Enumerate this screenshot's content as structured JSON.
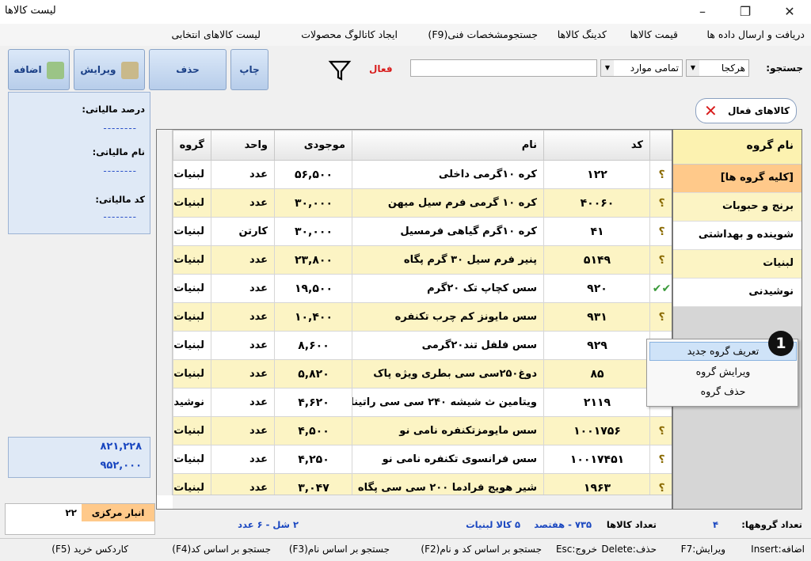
{
  "window": {
    "title": "لیست کالاها"
  },
  "menu": [
    "دریافت و ارسال داده ها",
    "قیمت کالاها",
    "کدینگ کالاها",
    "جستجومشخصات فنی(F9)",
    "ایجاد کاتالوگ محصولات",
    "لیست کالاهای انتخابی"
  ],
  "toolbar": {
    "add": "اضافه",
    "edit": "ویرایش",
    "delete": "حذف",
    "print": "چاپ"
  },
  "search": {
    "label": "جستجو:",
    "field": "هرکجا",
    "scope": "تمامی موارد",
    "value": "",
    "active_label": "فعال"
  },
  "left_panel": {
    "tax_percent_label": "درصد  مالیاتی:",
    "tax_name_label": "نام مالیاتی:",
    "tax_code_label": "کد مالیاتی:",
    "placeholder": "--------",
    "sum1": "۸۲۱,۲۲۸",
    "sum2": "۹۵۲,۰۰۰",
    "warehouse_name": "انبار مرکزی",
    "warehouse_qty": "۲۲"
  },
  "active_badge": "کالاهای فعال",
  "table": {
    "columns": [
      "کد",
      "نام",
      "موجودی",
      "واحد",
      "گروه"
    ],
    "rows": [
      {
        "mark": "؟",
        "code": "۱۲۲",
        "name": "کره ۱۰گرمی داخلی",
        "stock": "۵۶,۵۰۰",
        "unit": "عدد",
        "group": "لبنیات"
      },
      {
        "mark": "؟",
        "code": "۴۰۰۶۰",
        "name": "کره ۱۰ گرمی فرم سیل میهن",
        "stock": "۳۰,۰۰۰",
        "unit": "عدد",
        "group": "لبنیات"
      },
      {
        "mark": "؟",
        "code": "۴۱",
        "name": "کره ۱۰گرم گیاهی فرمسیل",
        "stock": "۳۰,۰۰۰",
        "unit": "کارتن",
        "group": "لبنیات"
      },
      {
        "mark": "؟",
        "code": "۵۱۴۹",
        "name": "پنیر فرم سیل ۳۰ گرم پگاه",
        "stock": "۲۳,۸۰۰",
        "unit": "عدد",
        "group": "لبنیات"
      },
      {
        "mark": "✔✔",
        "code": "۹۲۰",
        "name": "سس کچاپ تک ۲۰گرم",
        "stock": "۱۹,۵۰۰",
        "unit": "عدد",
        "group": "لبنیات"
      },
      {
        "mark": "؟",
        "code": "۹۳۱",
        "name": "سس مایونز کم چرب تکنفره",
        "stock": "۱۰,۴۰۰",
        "unit": "عدد",
        "group": "لبنیات"
      },
      {
        "mark": "؟",
        "code": "۹۲۹",
        "name": "سس فلفل تند۲۰گرمی",
        "stock": "۸,۶۰۰",
        "unit": "عدد",
        "group": "لبنیات"
      },
      {
        "mark": "؟",
        "code": "۸۵",
        "name": "دوغ۲۵۰سی سی بطری ویژه پاک",
        "stock": "۵,۸۲۰",
        "unit": "عدد",
        "group": "لبنیات"
      },
      {
        "mark": "✔✔",
        "code": "۲۱۱۹",
        "name": "ویتامین ث شیشه ۲۴۰ سی سی راتینا",
        "stock": "۴,۶۲۰",
        "unit": "عدد",
        "group": "نوشیدنی"
      },
      {
        "mark": "؟",
        "code": "۱۰۰۱۷۵۶",
        "name": "سس مایومزتکنفره نامی نو",
        "stock": "۴,۵۰۰",
        "unit": "عدد",
        "group": "لبنیات"
      },
      {
        "mark": "؟",
        "code": "۱۰۰۱۷۴۵۱",
        "name": "سس فرانسوی تکنفره نامی نو",
        "stock": "۴,۲۵۰",
        "unit": "عدد",
        "group": "لبنیات"
      },
      {
        "mark": "؟",
        "code": "۱۹۶۳",
        "name": "شیر هویج فرادما ۲۰۰ سی سی پگاه",
        "stock": "۳,۰۴۷",
        "unit": "عدد",
        "group": "لبنیات"
      }
    ]
  },
  "groups": {
    "header": "نام گروه",
    "items": [
      "[کلیه گروه ها]",
      "برنج و حبوبات",
      "شوینده و بهداشتی",
      "لبنیات",
      "نوشیدنی"
    ]
  },
  "context_menu": [
    "تعریف گروه جدید",
    "ویرایش گروه",
    "حذف گروه"
  ],
  "callout": "1",
  "info": {
    "group_count_label": "تعداد گروهها:",
    "group_count": "۴",
    "item_count_label": "تعداد کالاها",
    "item_count": "۷۳۵ - هفتصد",
    "group_text": "۵ کالا لبنیات",
    "summary": "۲ شل - ۶ عدد"
  },
  "shortcuts": [
    "اضافه:Insert",
    "ویرایش:F7",
    "حذف:Delete",
    "خروج:Esc",
    "جستجو بر اساس کد و نام(F2)",
    "جستجو بر اساس نام(F3)",
    "جستجو بر اساس کد(F4)",
    "کاردکس خرید (F5)"
  ],
  "colors": {
    "alt_row": "#fcf4c4",
    "selected_group": "#ffc98a",
    "button_text": "#1a3f86",
    "sum_text": "#1a47c0"
  }
}
